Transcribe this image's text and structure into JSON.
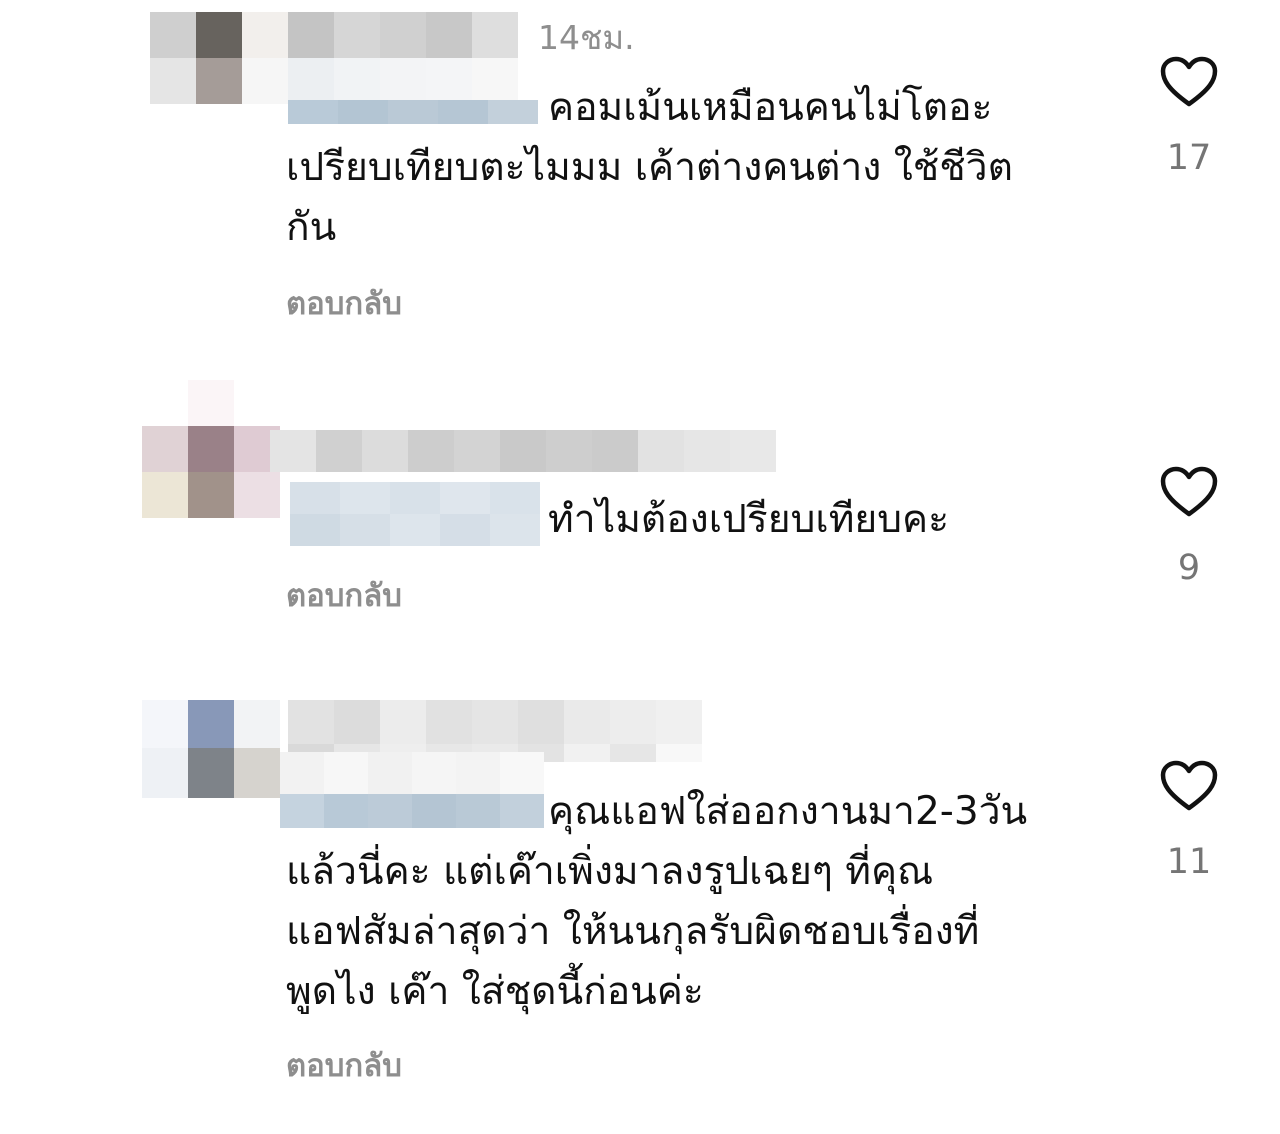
{
  "comments": [
    {
      "timestamp": "14ชม.",
      "text": "คอมเม้นเหมือนคนไม่โตอะ\nเปรียบเทียบตะไมมม เค้าต่างคนต่าง ใช้ชีวิต\nกัน",
      "reply_label": "ตอบกลับ",
      "like_count": "17",
      "like_icon": "heart-outline-icon"
    },
    {
      "text": "ทำไมต้องเปรียบเทียบคะ",
      "reply_label": "ตอบกลับ",
      "like_count": "9",
      "like_icon": "heart-outline-icon"
    },
    {
      "text": "คุณแอฟใส่ออกงานมา2-3วัน\nแล้วนี่คะ แต่เค๊าเพิ่งมาลงรูปเฉยๆ ที่คุณ\nแอฟสัมล่าสุดว่า ให้นนกุลรับผิดชอบเรื่องที่\nพูดไง เค๊า ใส่ชุดนี้ก่อนค่ะ",
      "reply_label": "ตอบกลับ",
      "like_count": "11",
      "like_icon": "heart-outline-icon"
    }
  ],
  "colors": {
    "text": "#111111",
    "secondary": "#8e8e8e",
    "background": "#ffffff"
  }
}
